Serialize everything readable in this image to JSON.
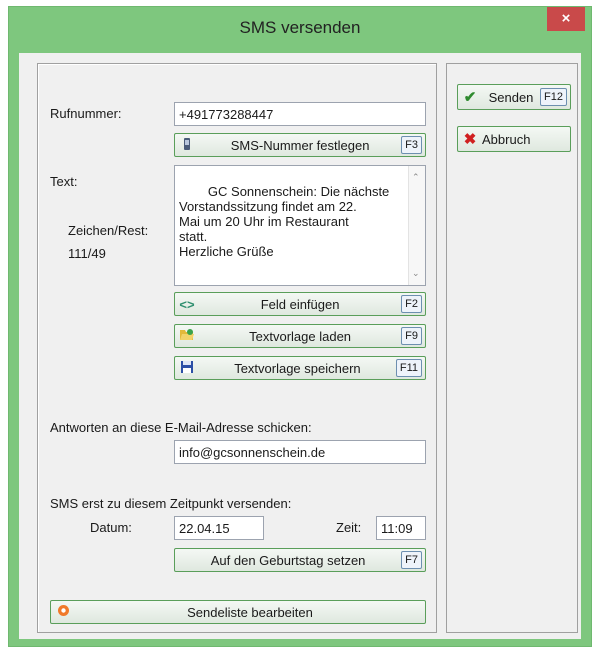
{
  "window": {
    "title": "SMS versenden",
    "close_glyph": "×"
  },
  "form": {
    "phone_label": "Rufnummer:",
    "phone_value": "+491773288447",
    "set_number_button": {
      "label": "SMS-Nummer festlegen",
      "key": "F3",
      "icon": "phone-icon"
    },
    "text_label": "Text:",
    "chars_label": "Zeichen/Rest:",
    "chars_value": "111/49",
    "message": "GC Sonnenschein: Die nächste\nVorstandssitzung findet am 22.\nMai um 20 Uhr im Restaurant\nstatt.\nHerzliche Grüße",
    "insert_field_button": {
      "label": "Feld einfügen",
      "key": "F2",
      "icon": "code-icon"
    },
    "load_template_button": {
      "label": "Textvorlage laden",
      "key": "F9",
      "icon": "folder-open-icon"
    },
    "save_template_button": {
      "label": "Textvorlage speichern",
      "key": "F11",
      "icon": "floppy-icon"
    },
    "reply_email_label": "Antworten an diese E-Mail-Adresse schicken:",
    "reply_email_value": "info@gcsonnenschein.de",
    "schedule_label": "SMS erst zu diesem Zeitpunkt versenden:",
    "date_label": "Datum:",
    "date_value": "22.04.15",
    "time_label": "Zeit:",
    "time_value": "11:09",
    "birthday_button": {
      "label": "Auf den Geburtstag setzen",
      "key": "F7"
    },
    "sendlist_button": {
      "label": "Sendeliste bearbeiten",
      "icon": "circle-icon"
    }
  },
  "actions": {
    "send_button": {
      "label": "Senden",
      "key": "F12",
      "icon": "check-icon"
    },
    "cancel_button": {
      "label": "Abbruch",
      "icon": "x-icon"
    }
  },
  "colors": {
    "frame": "#7ec77e",
    "close": "#c94a4a",
    "button_border": "#5a9e5a"
  }
}
